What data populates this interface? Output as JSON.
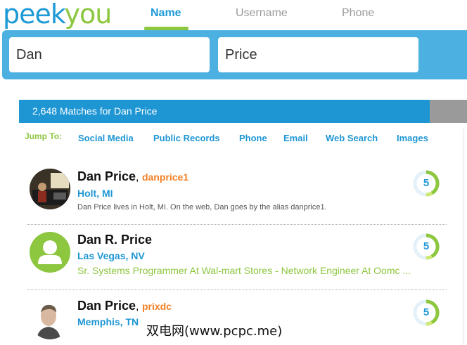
{
  "logo": {
    "part1": "peek",
    "part2": "you"
  },
  "tabs": [
    {
      "label": "Name"
    },
    {
      "label": "Username"
    },
    {
      "label": "Phone"
    }
  ],
  "search": {
    "first_value": "Dan",
    "last_value": "Price"
  },
  "results_bar": {
    "text": "2,648 Matches for Dan Price"
  },
  "jump": {
    "label": "Jump To:",
    "links": [
      "Social Media",
      "Public Records",
      "Phone",
      "Email",
      "Web Search",
      "Images"
    ]
  },
  "results": [
    {
      "name": "Dan Price",
      "alias": "danprice1",
      "location": "Holt, MI",
      "description": "Dan Price lives in Holt, MI. On the web, Dan goes by the alias danprice1.",
      "score": "5"
    },
    {
      "name": "Dan R. Price",
      "alias": "",
      "location": "Las Vegas, NV",
      "description": "Sr. Systems Programmer At Wal-mart Stores - Network Engineer At Oomc ...",
      "score": "5"
    },
    {
      "name": "Dan Price",
      "alias": "prixdc",
      "location": "Memphis, TN",
      "description": "",
      "score": "5"
    }
  ],
  "watermark": "双电网(www.pcpc.me)",
  "colors": {
    "brand_blue": "#1e96d4",
    "brand_green": "#8dc63f",
    "alias_orange": "#f58025"
  }
}
